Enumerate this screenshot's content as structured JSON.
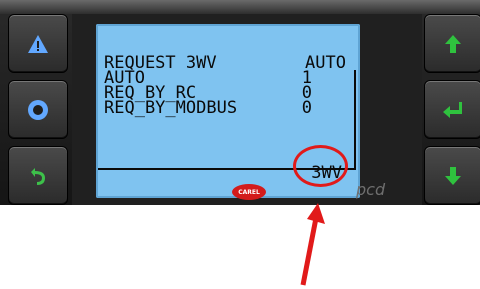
{
  "lcd": {
    "line1_label": "REQUEST 3WV",
    "line1_value": "AUTO",
    "line2_label": "AUTO",
    "line2_value": "1",
    "line3_label": "REQ_BY_RC",
    "line3_value": "0",
    "line4_label": "REQ_BY_MODBUS",
    "line4_value": "0",
    "bottom_code": "3WV"
  },
  "device": {
    "logo_text": "CAREL",
    "brand_text": "pcd"
  },
  "buttons": {
    "left": [
      "alarm-button",
      "prg-button",
      "esc-button"
    ],
    "right": [
      "up-button",
      "enter-button",
      "down-button"
    ]
  },
  "colors": {
    "lcd_background": "#7fc3f0",
    "left_icons": "#62a8ff",
    "esc_icon": "#3dc14a",
    "right_icons": "#2fc23e",
    "annotation": "#e11a1a",
    "logo": "#d31b1b"
  }
}
